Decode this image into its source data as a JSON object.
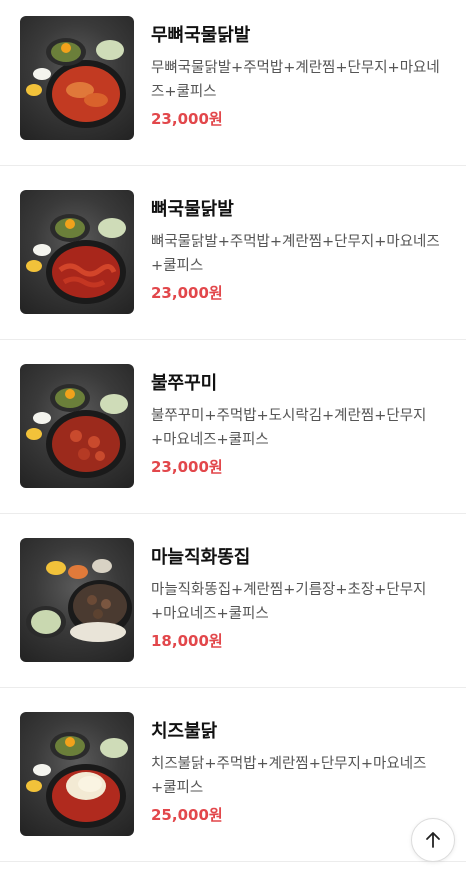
{
  "menu": {
    "items": [
      {
        "name": "무뼈국물닭발",
        "description": "무뼈국물닭발+주먹밥+계란찜+단무지+마요네즈+쿨피스",
        "price": "23,000원",
        "image_icon": "food-photo"
      },
      {
        "name": "뼈국물닭발",
        "description": "뼈국물닭발+주먹밥+계란찜+단무지+마요네즈+쿨피스",
        "price": "23,000원",
        "image_icon": "food-photo"
      },
      {
        "name": "불쭈꾸미",
        "description": "불쭈꾸미+주먹밥+도시락김+계란찜+단무지+마요네즈+쿨피스",
        "price": "23,000원",
        "image_icon": "food-photo"
      },
      {
        "name": "마늘직화똥집",
        "description": "마늘직화똥집+계란찜+기름장+초장+단무지+마요네즈+쿨피스",
        "price": "18,000원",
        "image_icon": "food-photo"
      },
      {
        "name": "치즈불닭",
        "description": "치즈불닭+주먹밥+계란찜+단무지+마요네즈+쿨피스",
        "price": "25,000원",
        "image_icon": "food-photo"
      }
    ]
  },
  "scroll_top_button": {
    "icon": "arrow-up-icon"
  },
  "colors": {
    "price": "#e2474b",
    "divider": "#ececec"
  }
}
